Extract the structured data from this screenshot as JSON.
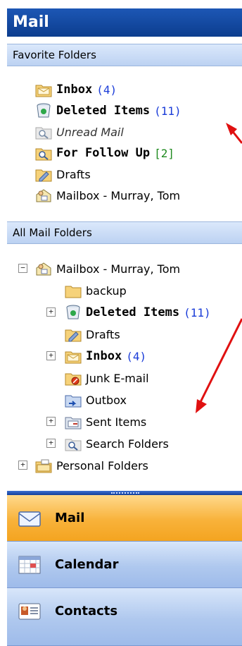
{
  "pane": {
    "title": "Mail"
  },
  "favorites": {
    "header": "Favorite Folders",
    "items": [
      {
        "label": "Inbox",
        "count": "(4)",
        "icon": "inbox-folder-icon"
      },
      {
        "label": "Deleted Items",
        "count": "(11)",
        "icon": "trash-can-icon"
      },
      {
        "label": "Unread Mail",
        "count": "",
        "icon": "search-folder-icon"
      },
      {
        "label": "For Follow Up",
        "count": "[2]",
        "icon": "search-folder-icon"
      },
      {
        "label": "Drafts",
        "count": "",
        "icon": "drafts-folder-icon"
      },
      {
        "label": "Mailbox - Murray, Tom",
        "count": "",
        "icon": "mailbox-icon"
      }
    ]
  },
  "all_folders": {
    "header": "All Mail Folders",
    "items": [
      {
        "label": "Mailbox - Murray, Tom",
        "count": "",
        "expander": "−"
      },
      {
        "label": "backup",
        "count": ""
      },
      {
        "label": "Deleted Items",
        "count": "(11)",
        "expander": "+"
      },
      {
        "label": "Drafts",
        "count": ""
      },
      {
        "label": "Inbox",
        "count": "(4)",
        "expander": "+"
      },
      {
        "label": "Junk E-mail",
        "count": ""
      },
      {
        "label": "Outbox",
        "count": ""
      },
      {
        "label": "Sent Items",
        "count": "",
        "expander": "+"
      },
      {
        "label": "Search Folders",
        "count": "",
        "expander": "+"
      },
      {
        "label": "Personal Folders",
        "count": "",
        "expander": "+"
      }
    ]
  },
  "nav": {
    "mail": "Mail",
    "calendar": "Calendar",
    "contacts": "Contacts"
  },
  "colors": {
    "accent": "#0c3d8e",
    "count": "#1a3cd8",
    "follow_up": "#1f8a1f",
    "annotation_arrow": "#e01010",
    "selected_nav": "#f8b23a"
  }
}
